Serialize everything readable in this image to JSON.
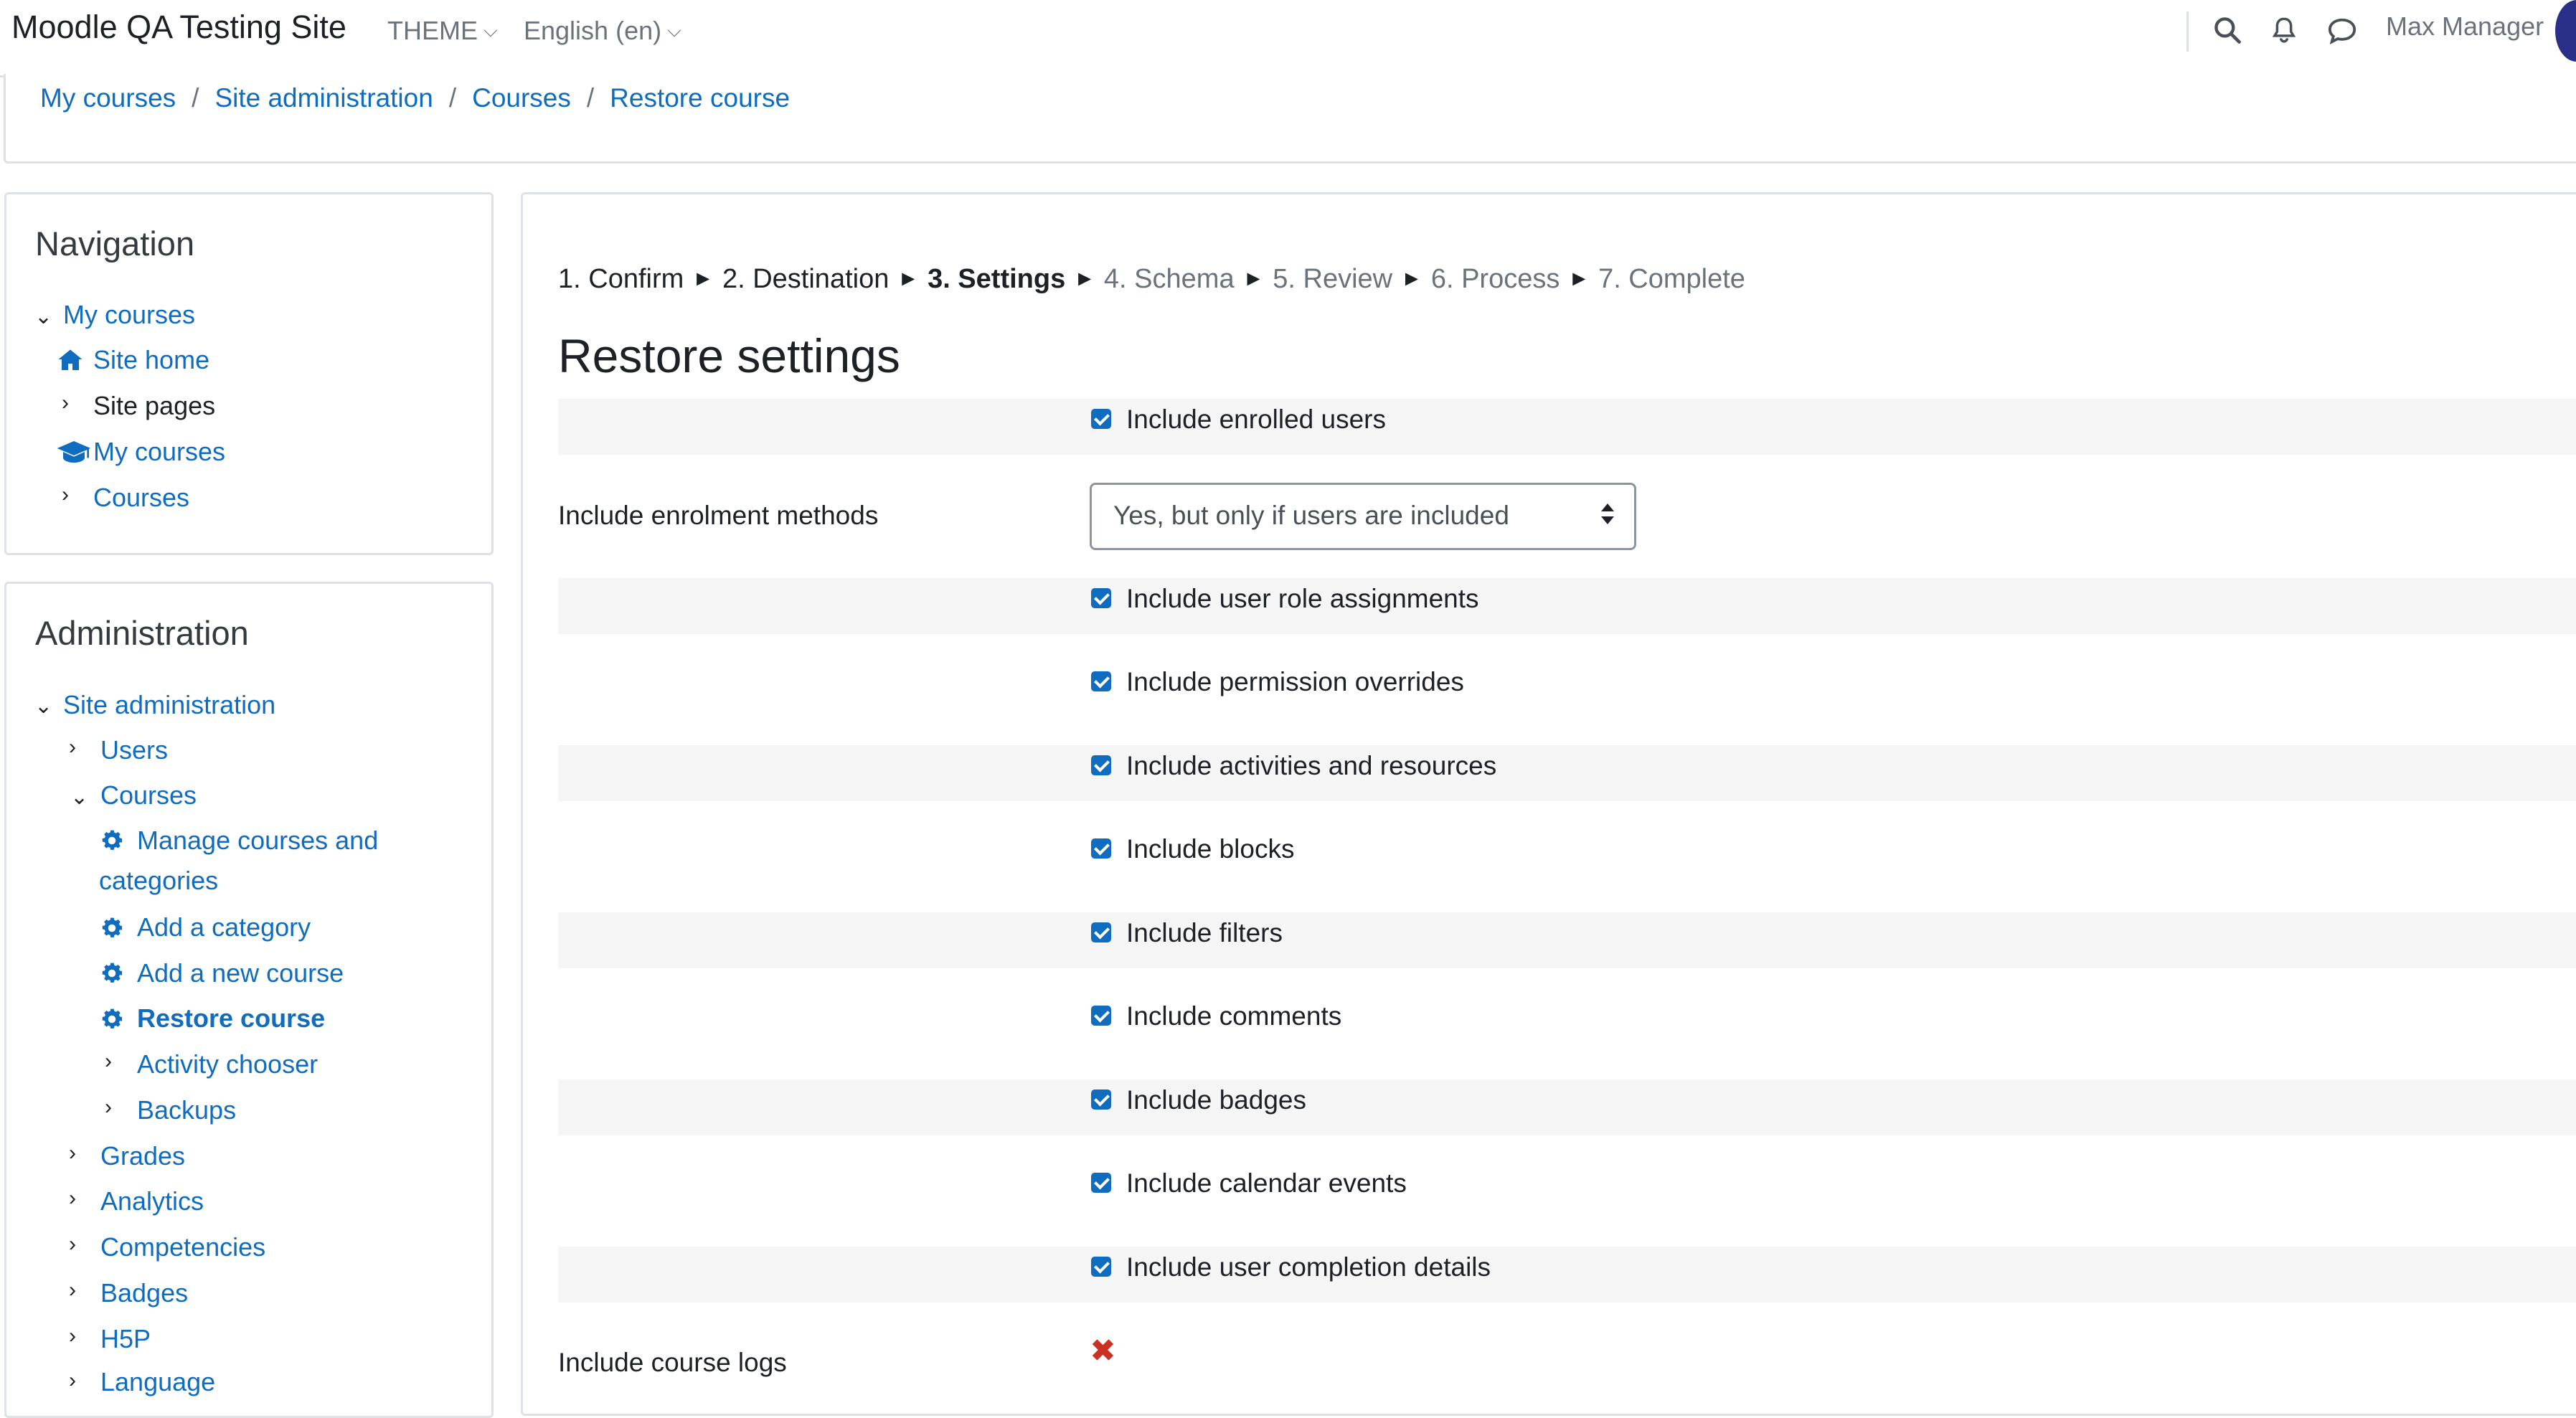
{
  "header": {
    "site_name": "Moodle QA Testing Site",
    "theme_menu": "THEME",
    "language_menu": "English (en)",
    "user_name": "Max Manager",
    "icons": [
      "search-icon",
      "bell-icon",
      "chat-icon",
      "chevron-down-icon"
    ]
  },
  "breadcrumb": [
    "My courses",
    "Site administration",
    "Courses",
    "Restore course"
  ],
  "navigation": {
    "title": "Navigation",
    "items": [
      "My courses",
      "Site home",
      "Site pages",
      "My courses",
      "Courses"
    ]
  },
  "administration": {
    "title": "Administration",
    "site_admin": "Site administration",
    "users": "Users",
    "courses": "Courses",
    "manage_courses_line1": "Manage courses and",
    "manage_courses_line2": "categories",
    "add_category": "Add a category",
    "add_course": "Add a new course",
    "restore_course": "Restore course",
    "activity_chooser": "Activity chooser",
    "backups": "Backups",
    "grades": "Grades",
    "analytics": "Analytics",
    "competencies": "Competencies",
    "badges": "Badges",
    "h5p": "H5P",
    "language": "Language"
  },
  "steps": [
    "1. Confirm",
    "2. Destination",
    "3. Settings",
    "4. Schema",
    "5. Review",
    "6. Process",
    "7. Complete"
  ],
  "current_step": "3. Settings",
  "form": {
    "title": "Restore settings",
    "enrolled_users": "Include enrolled users",
    "enrolment_methods_label": "Include enrolment methods",
    "enrolment_methods_value": "Yes, but only if users are included",
    "role_assignments": "Include user role assignments",
    "permission_overrides": "Include permission overrides",
    "activities": "Include activities and resources",
    "blocks": "Include blocks",
    "filters": "Include filters",
    "comments": "Include comments",
    "badges": "Include badges",
    "calendar_events": "Include calendar events",
    "completion_details": "Include user completion details",
    "course_logs_label": "Include course logs",
    "course_logs_value": "✖"
  },
  "colors": {
    "link": "#0f6cbf",
    "checkbox": "#0f6cbf",
    "row_shade": "#f5f5f5",
    "error": "#ca3120"
  }
}
